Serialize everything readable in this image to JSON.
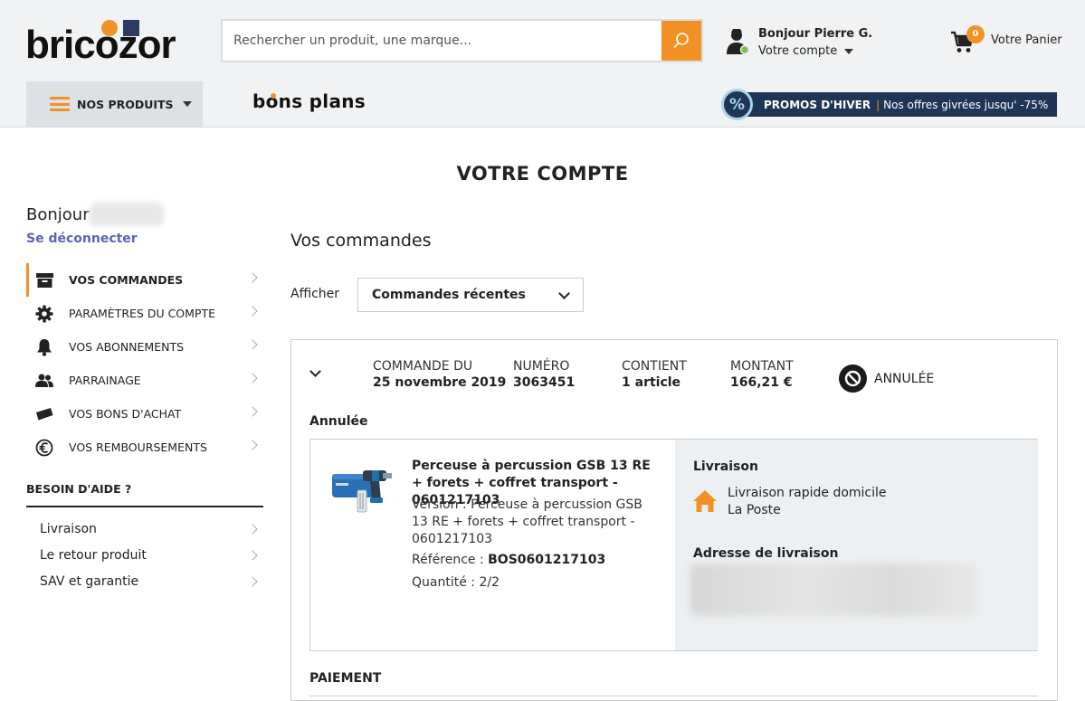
{
  "header": {
    "logo": "bricozor",
    "search": {
      "placeholder": "Rechercher un produit, une marque..."
    },
    "account": {
      "greeting": "Bonjour Pierre G.",
      "label": "Votre compte"
    },
    "cart": {
      "count": "0",
      "label": "Votre Panier"
    }
  },
  "nav": {
    "products": "NOS PRODUITS",
    "bonsplans": {
      "prefix": "b",
      "o": "o",
      "suffix": "ns plans"
    },
    "promo": {
      "title": "PROMOS D'HIVER",
      "separator": "|",
      "text": "Nos offres givrées jusqu' -75%",
      "badge": "%"
    }
  },
  "page": {
    "title": "VOTRE COMPTE"
  },
  "sidebar": {
    "hello": "Bonjour",
    "logout": "Se déconnecter",
    "menu": [
      {
        "label": "VOS COMMANDES",
        "icon": "archive-box-icon"
      },
      {
        "label": "PARAMÈTRES DU COMPTE",
        "icon": "gear-icon"
      },
      {
        "label": "VOS ABONNEMENTS",
        "icon": "bell-icon"
      },
      {
        "label": "PARRAINAGE",
        "icon": "users-icon"
      },
      {
        "label": "VOS BONS D'ACHAT",
        "icon": "ticket-icon"
      },
      {
        "label": "VOS REMBOURSEMENTS",
        "icon": "euro-icon"
      }
    ],
    "help": {
      "title": "BESOIN D'AIDE ?",
      "items": [
        "Livraison",
        "Le retour produit",
        "SAV et garantie"
      ]
    }
  },
  "orders": {
    "title": "Vos commandes",
    "filter_label": "Afficher",
    "filter_value": "Commandes récentes",
    "order": {
      "date_label": "COMMANDE DU",
      "date": "25 novembre 2019",
      "number_label": "NUMÉRO",
      "number": "3063451",
      "contains_label": "CONTIENT",
      "contains": "1 article",
      "amount_label": "MONTANT",
      "amount": "166,21 €",
      "status": "ANNULÉE",
      "state": "Annulée",
      "item": {
        "name": "Perceuse à percussion GSB 13 RE + forets + coffret transport - 0601217103",
        "version": "Version : Perceuse à percussion GSB 13 RE + forets + coffret transport - 0601217103",
        "ref_label": "Référence : ",
        "ref": "BOS0601217103",
        "qty": "Quantité : 2/2"
      },
      "shipping": {
        "title": "Livraison",
        "mode": "Livraison rapide domicile",
        "carrier": "La Poste",
        "address_title": "Adresse de livraison"
      },
      "payment_title": "PAIEMENT"
    }
  },
  "colors": {
    "accent": "#f39224",
    "navy": "#1e3556",
    "link": "#5a64b8"
  }
}
